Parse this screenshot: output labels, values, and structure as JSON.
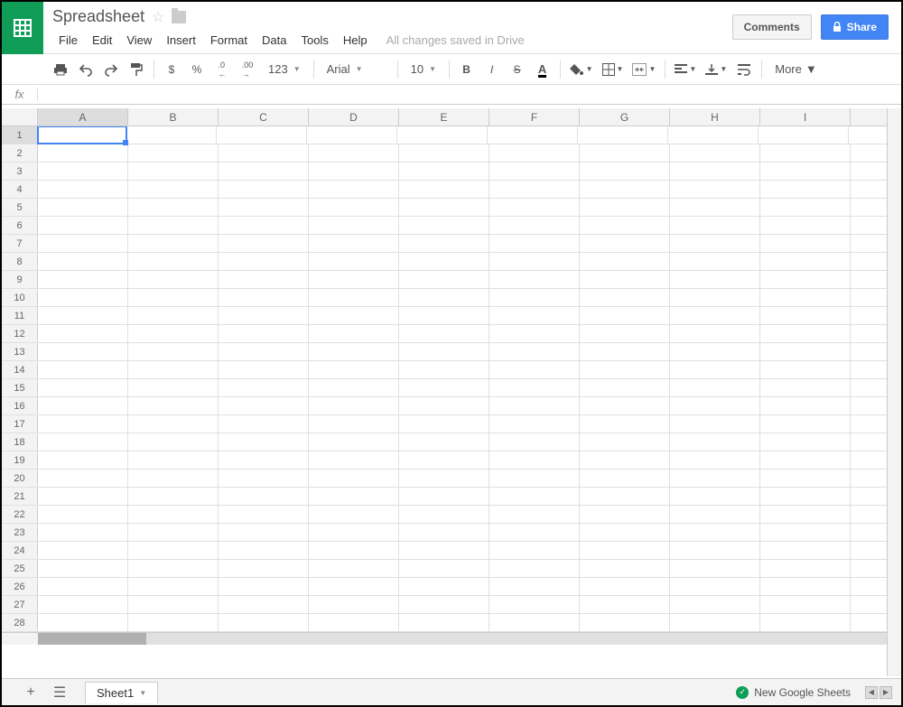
{
  "header": {
    "doc_title": "Spreadsheet",
    "save_status": "All changes saved in Drive",
    "comments_label": "Comments",
    "share_label": "Share"
  },
  "menu": {
    "items": [
      "File",
      "Edit",
      "View",
      "Insert",
      "Format",
      "Data",
      "Tools",
      "Help"
    ]
  },
  "toolbar": {
    "currency": "$",
    "percent": "%",
    "dec_less": ".0",
    "dec_more": ".00",
    "num_format": "123",
    "font": "Arial",
    "font_size": "10",
    "bold": "B",
    "italic": "I",
    "strike": "S",
    "text_color": "A",
    "more": "More"
  },
  "formula_bar": {
    "fx": "fx",
    "value": ""
  },
  "grid": {
    "columns": [
      "A",
      "B",
      "C",
      "D",
      "E",
      "F",
      "G",
      "H",
      "I"
    ],
    "rows": [
      "1",
      "2",
      "3",
      "4",
      "5",
      "6",
      "7",
      "8",
      "9",
      "10",
      "11",
      "12",
      "13",
      "14",
      "15",
      "16",
      "17",
      "18",
      "19",
      "20",
      "21",
      "22",
      "23",
      "24",
      "25",
      "26",
      "27",
      "28"
    ],
    "active_cell": "A1"
  },
  "footer": {
    "sheet_name": "Sheet1",
    "status": "New Google Sheets"
  }
}
